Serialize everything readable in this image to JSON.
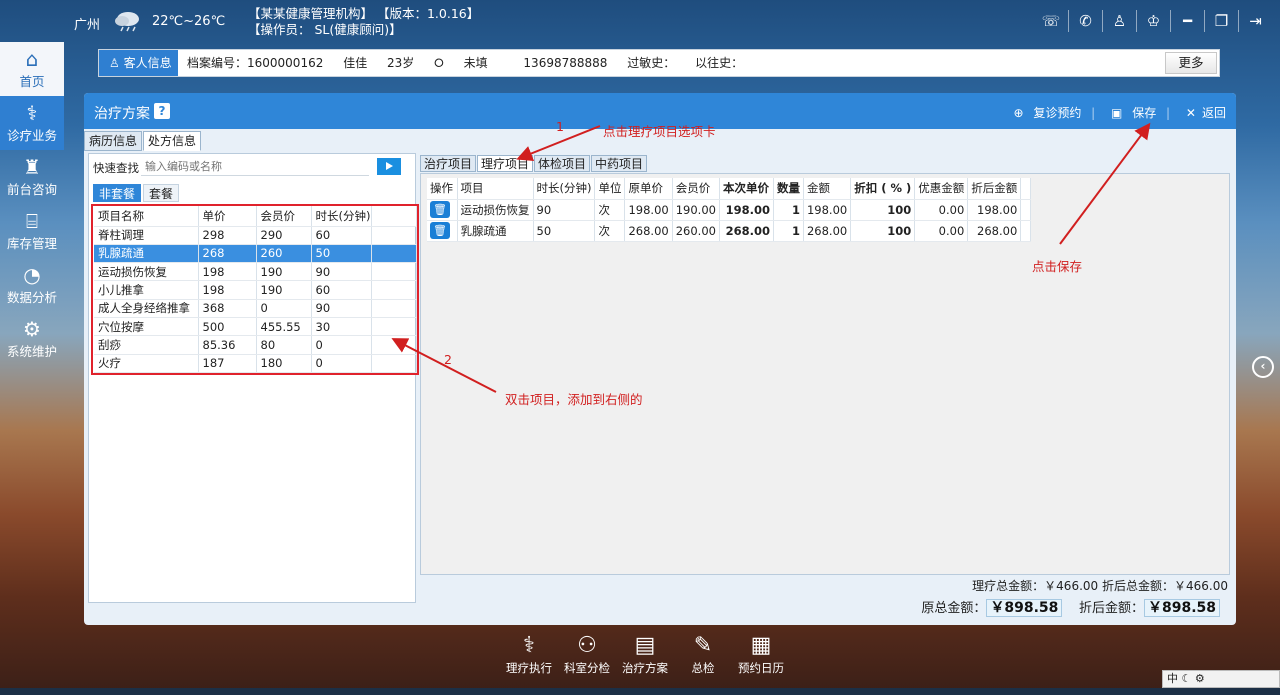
{
  "topbar": {
    "city": "广州",
    "temperature": "22℃~26℃",
    "org_line": "【某某健康管理机构】  【版本：1.0.16】",
    "operator_line": "【操作员： SL(健康顾问)】",
    "icons": [
      "chat-icon",
      "phone-icon",
      "user-icon",
      "shirt-icon",
      "minimize-icon",
      "restore-icon",
      "exit-icon"
    ]
  },
  "sidebar": {
    "items": [
      {
        "label": "首页",
        "icon": "home-icon"
      },
      {
        "label": "诊疗业务",
        "icon": "doctor-icon"
      },
      {
        "label": "前台咨询",
        "icon": "nurse-icon"
      },
      {
        "label": "库存管理",
        "icon": "store-icon"
      },
      {
        "label": "数据分析",
        "icon": "chart-icon"
      },
      {
        "label": "系统维护",
        "icon": "gear-icon"
      }
    ]
  },
  "patient": {
    "tag": "客人信息",
    "file_no": "档案编号：1600000162",
    "name": "佳佳",
    "age": "23岁",
    "status": "未填",
    "phone": "13698788888",
    "allergy": "过敏史：",
    "history": "以往史：",
    "more": "更多"
  },
  "panel": {
    "title": "治疗方案",
    "help": "?",
    "actions": {
      "revisit": "复诊预约",
      "save": "保存",
      "back": "返回"
    },
    "subtabs": [
      "病历信息",
      "处方信息"
    ]
  },
  "left": {
    "quick_label": "快速查找",
    "quick_placeholder": "输入编码或名称",
    "pkg_tabs": [
      "非套餐",
      "套餐"
    ],
    "headers": [
      "项目名称",
      "单价",
      "会员价",
      "时长(分钟)"
    ],
    "rows": [
      [
        "脊柱调理",
        "298",
        "290",
        "60"
      ],
      [
        "乳腺疏通",
        "268",
        "260",
        "50"
      ],
      [
        "运动损伤恢复",
        "198",
        "190",
        "90"
      ],
      [
        "小儿推拿",
        "198",
        "190",
        "60"
      ],
      [
        "成人全身经络推拿",
        "368",
        "0",
        "90"
      ],
      [
        "穴位按摩",
        "500",
        "455.55",
        "30"
      ],
      [
        "刮痧",
        "85.36",
        "80",
        "0"
      ],
      [
        "火疗",
        "187",
        "180",
        "0"
      ]
    ]
  },
  "right": {
    "tabs": [
      "治疗项目",
      "理疗项目",
      "体检项目",
      "中药项目"
    ],
    "headers": [
      "操作",
      "项目",
      "时长(分钟)",
      "单位",
      "原单价",
      "会员价",
      "本次单价",
      "数量",
      "金额",
      "折扣 ( % )",
      "优惠金额",
      "折后金额"
    ],
    "rows": [
      [
        "运动损伤恢复",
        "90",
        "次",
        "198.00",
        "190.00",
        "198.00",
        "1",
        "198.00",
        "100",
        "0.00",
        "198.00"
      ],
      [
        "乳腺疏通",
        "50",
        "次",
        "268.00",
        "260.00",
        "268.00",
        "1",
        "268.00",
        "100",
        "0.00",
        "268.00"
      ]
    ],
    "subtotal": "理疗总金额：￥466.00",
    "subtotal_discount": "折后总金额：￥466.00",
    "total_label": "原总金额：",
    "total_value": "￥898.58",
    "total_discount_label": "折后金额：",
    "total_discount_value": "￥898.58"
  },
  "annotations": {
    "step1_num": "1",
    "step1_text": "点击理疗项目选项卡",
    "step2_num": "2",
    "step2_text": "双击项目，添加到右侧的",
    "save_text": "点击保存",
    "color": "#d11f1f"
  },
  "dock": [
    "理疗执行",
    "科室分检",
    "治疗方案",
    "总检",
    "预约日历"
  ],
  "ime": "中"
}
